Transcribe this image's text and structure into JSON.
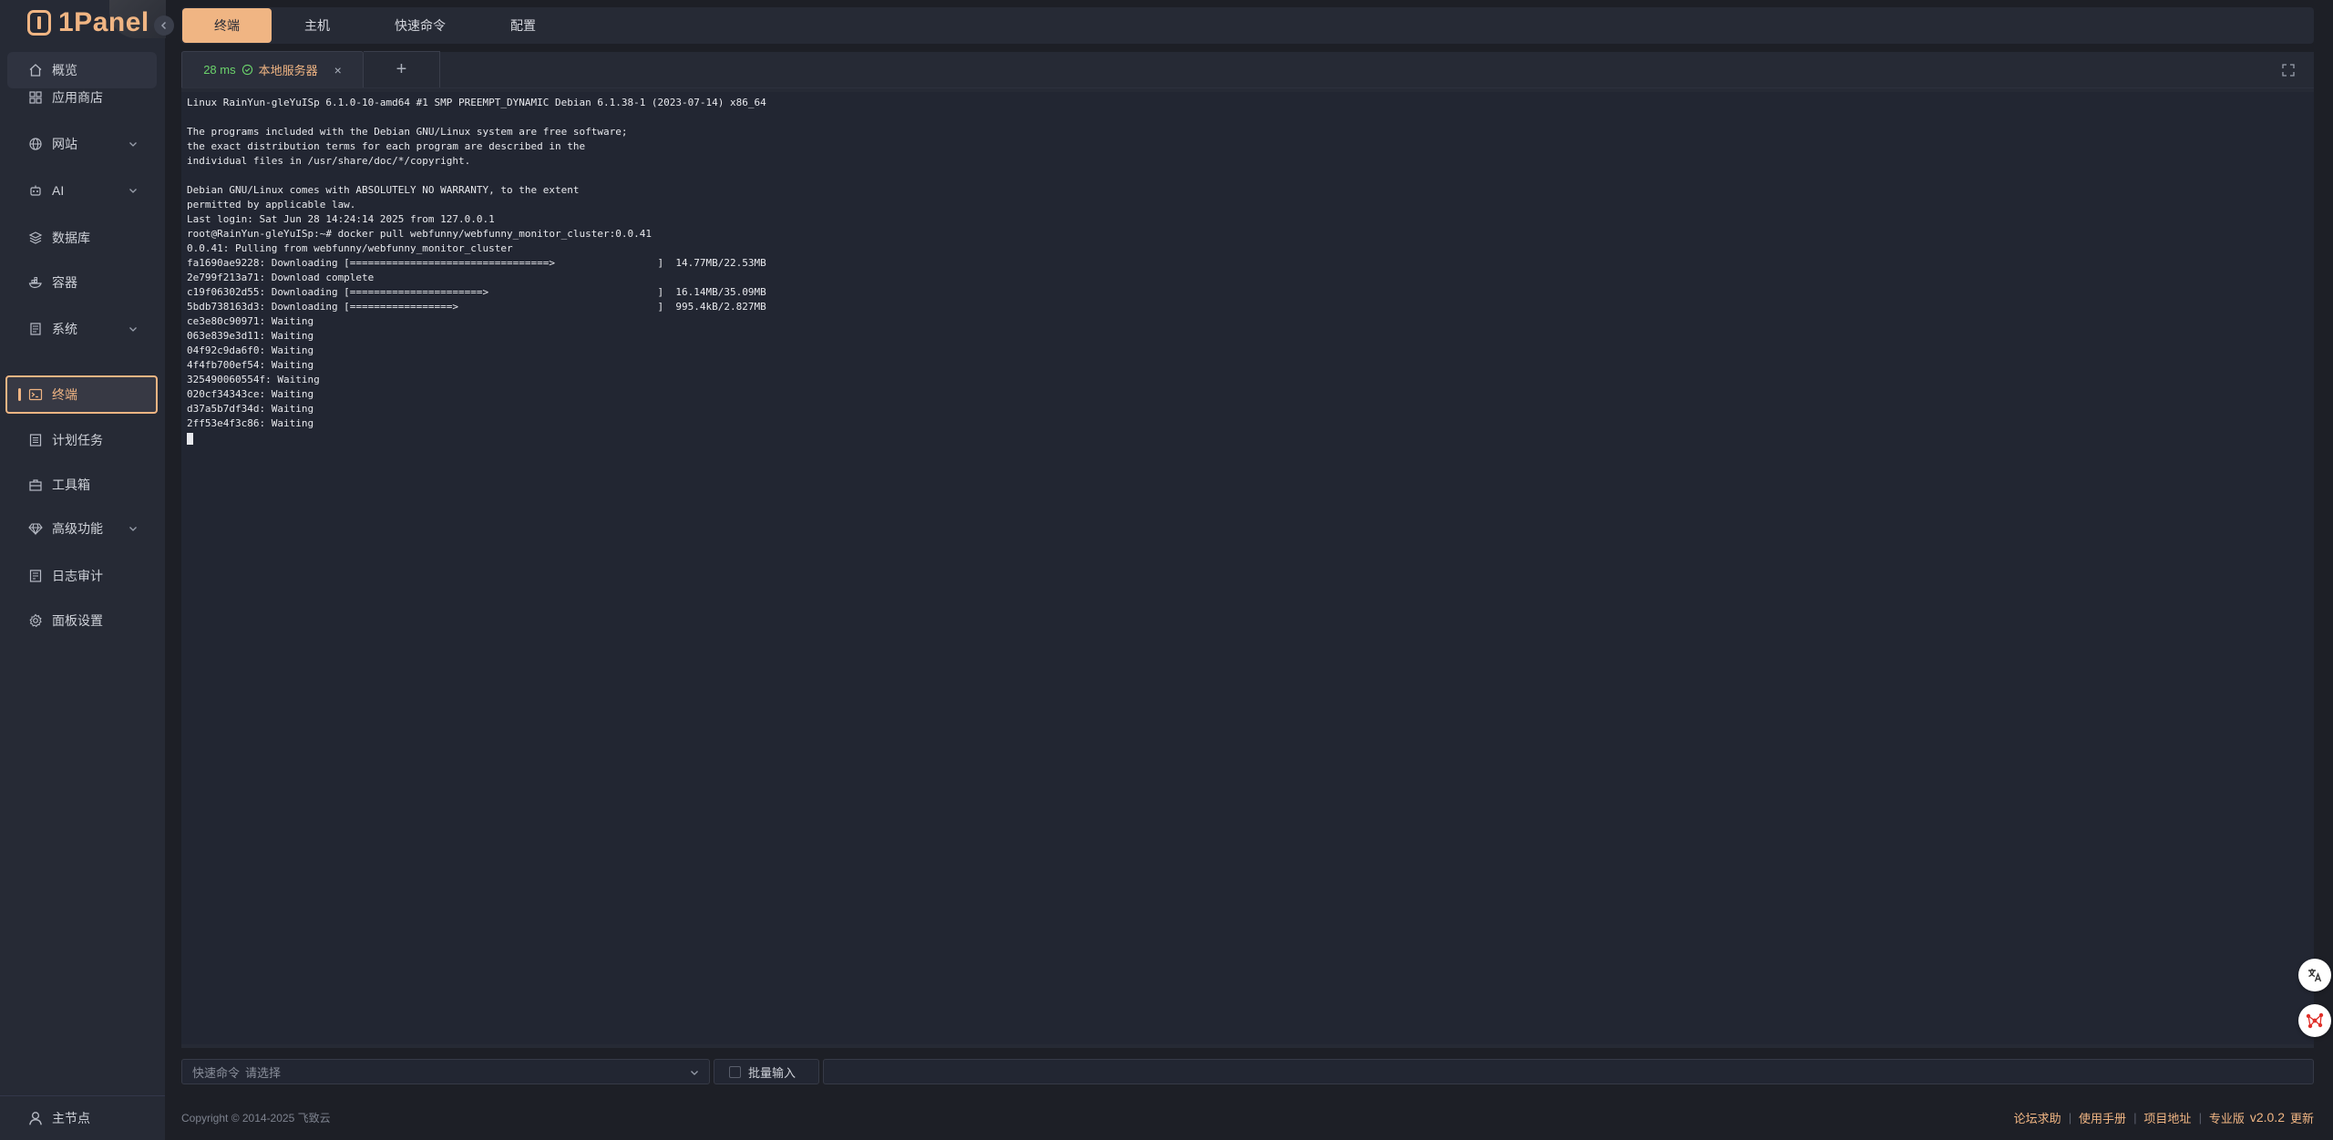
{
  "app": {
    "logo_text": "1Panel"
  },
  "sidebar": {
    "items": [
      {
        "label": "概览",
        "icon": "home-icon",
        "arrow": false
      },
      {
        "label": "应用商店",
        "icon": "grid-icon",
        "arrow": false
      },
      {
        "label": "网站",
        "icon": "globe-icon",
        "arrow": true
      },
      {
        "label": "AI",
        "icon": "robot-icon",
        "arrow": true
      },
      {
        "label": "数据库",
        "icon": "database-icon",
        "arrow": false
      },
      {
        "label": "容器",
        "icon": "container-icon",
        "arrow": false
      },
      {
        "label": "系统",
        "icon": "system-icon",
        "arrow": true
      },
      {
        "label": "终端",
        "icon": "terminal-icon",
        "arrow": false,
        "active": true
      },
      {
        "label": "计划任务",
        "icon": "list-icon",
        "arrow": false
      },
      {
        "label": "工具箱",
        "icon": "toolbox-icon",
        "arrow": false
      },
      {
        "label": "高级功能",
        "icon": "diamond-icon",
        "arrow": true
      },
      {
        "label": "日志审计",
        "icon": "log-icon",
        "arrow": false
      },
      {
        "label": "面板设置",
        "icon": "gear-icon",
        "arrow": false
      }
    ],
    "footer_label": "主节点"
  },
  "topnav": {
    "tabs": [
      "终端",
      "主机",
      "快速命令",
      "配置"
    ],
    "active": 0
  },
  "terminal": {
    "tab": {
      "latency": "28 ms",
      "host": "本地服务器",
      "close": "×"
    },
    "add_label": "+",
    "lines": [
      "Linux RainYun-gleYuISp 6.1.0-10-amd64 #1 SMP PREEMPT_DYNAMIC Debian 6.1.38-1 (2023-07-14) x86_64",
      "",
      "The programs included with the Debian GNU/Linux system are free software;",
      "the exact distribution terms for each program are described in the",
      "individual files in /usr/share/doc/*/copyright.",
      "",
      "Debian GNU/Linux comes with ABSOLUTELY NO WARRANTY, to the extent",
      "permitted by applicable law.",
      "Last login: Sat Jun 28 14:24:14 2025 from 127.0.0.1",
      "root@RainYun-gleYuISp:~# docker pull webfunny/webfunny_monitor_cluster:0.0.41",
      "0.0.41: Pulling from webfunny/webfunny_monitor_cluster",
      "fa1690ae9228: Downloading [=================================>                 ]  14.77MB/22.53MB",
      "2e799f213a71: Download complete",
      "c19f06302d55: Downloading [======================>                            ]  16.14MB/35.09MB",
      "5bdb738163d3: Downloading [=================>                                 ]  995.4kB/2.827MB",
      "ce3e80c90971: Waiting",
      "063e839e3d11: Waiting",
      "04f92c9da6f0: Waiting",
      "4f4fb700ef54: Waiting",
      "325490060554f: Waiting",
      "020cf34343ce: Waiting",
      "d37a5b7df34d: Waiting",
      "2ff53e4f3c86: Waiting"
    ]
  },
  "command_bar": {
    "select_label": "快速命令",
    "select_placeholder": "请选择",
    "batch_label": "批量输入"
  },
  "footer": {
    "copyright": "Copyright © 2014-2025 飞致云",
    "links": [
      "论坛求助",
      "使用手册",
      "项目地址"
    ],
    "edition": "专业版",
    "version": "v2.0.2",
    "update": "更新"
  },
  "colors": {
    "accent": "#f0b583",
    "sidebar_bg": "#262a35",
    "page_bg": "#1d1f26",
    "terminal_bg": "#222632",
    "latency_green": "#6bd36b"
  }
}
